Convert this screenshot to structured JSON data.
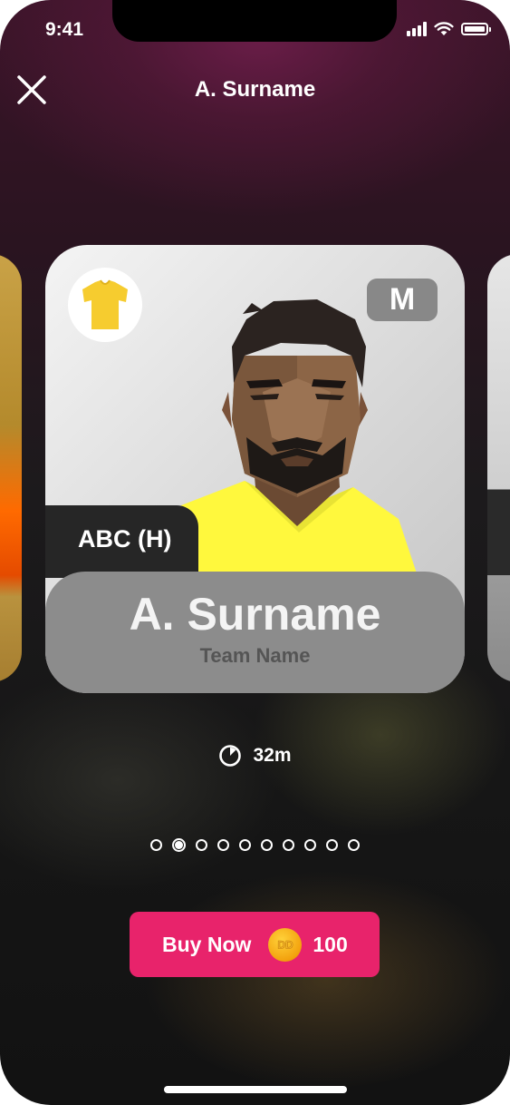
{
  "status_bar": {
    "time": "9:41",
    "battery_level": 1.0
  },
  "header": {
    "title": "A. Surname",
    "close_icon": "close-icon"
  },
  "card": {
    "position": "M",
    "fixture": "ABC (H)",
    "player_name": "A. Surname",
    "team_name": "Team Name",
    "kit_color": "#f6cc2f",
    "shirt_color": "#fff83d"
  },
  "timer": {
    "icon": "clock-icon",
    "text": "32m"
  },
  "pagination": {
    "count": 10,
    "active_index": 1
  },
  "buy_button": {
    "label": "Buy Now",
    "coin_icon": "coin-icon",
    "coin_text": "DD",
    "price": "100",
    "color": "#e8236b"
  }
}
